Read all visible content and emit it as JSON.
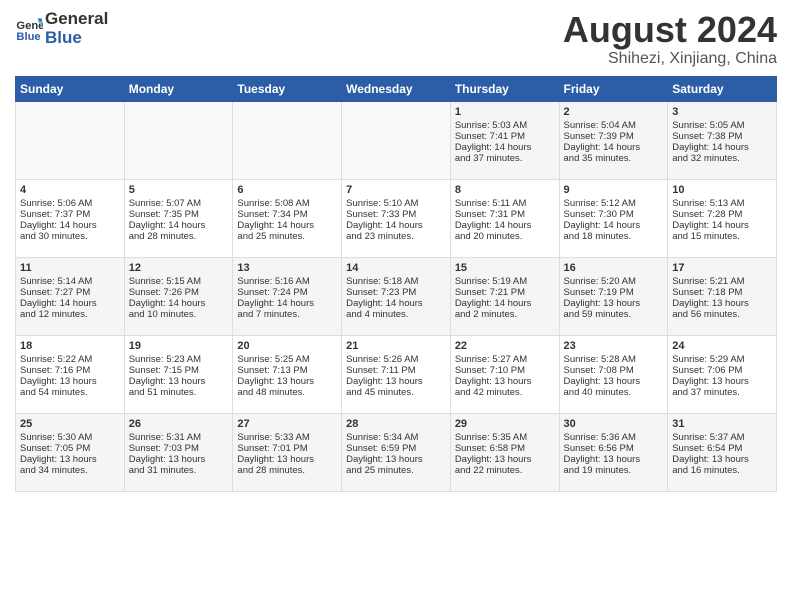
{
  "logo": {
    "line1": "General",
    "line2": "Blue"
  },
  "title": "August 2024",
  "subtitle": "Shihezi, Xinjiang, China",
  "days_of_week": [
    "Sunday",
    "Monday",
    "Tuesday",
    "Wednesday",
    "Thursday",
    "Friday",
    "Saturday"
  ],
  "weeks": [
    [
      {
        "day": "",
        "info": ""
      },
      {
        "day": "",
        "info": ""
      },
      {
        "day": "",
        "info": ""
      },
      {
        "day": "",
        "info": ""
      },
      {
        "day": "1",
        "info": "Sunrise: 5:03 AM\nSunset: 7:41 PM\nDaylight: 14 hours\nand 37 minutes."
      },
      {
        "day": "2",
        "info": "Sunrise: 5:04 AM\nSunset: 7:39 PM\nDaylight: 14 hours\nand 35 minutes."
      },
      {
        "day": "3",
        "info": "Sunrise: 5:05 AM\nSunset: 7:38 PM\nDaylight: 14 hours\nand 32 minutes."
      }
    ],
    [
      {
        "day": "4",
        "info": "Sunrise: 5:06 AM\nSunset: 7:37 PM\nDaylight: 14 hours\nand 30 minutes."
      },
      {
        "day": "5",
        "info": "Sunrise: 5:07 AM\nSunset: 7:35 PM\nDaylight: 14 hours\nand 28 minutes."
      },
      {
        "day": "6",
        "info": "Sunrise: 5:08 AM\nSunset: 7:34 PM\nDaylight: 14 hours\nand 25 minutes."
      },
      {
        "day": "7",
        "info": "Sunrise: 5:10 AM\nSunset: 7:33 PM\nDaylight: 14 hours\nand 23 minutes."
      },
      {
        "day": "8",
        "info": "Sunrise: 5:11 AM\nSunset: 7:31 PM\nDaylight: 14 hours\nand 20 minutes."
      },
      {
        "day": "9",
        "info": "Sunrise: 5:12 AM\nSunset: 7:30 PM\nDaylight: 14 hours\nand 18 minutes."
      },
      {
        "day": "10",
        "info": "Sunrise: 5:13 AM\nSunset: 7:28 PM\nDaylight: 14 hours\nand 15 minutes."
      }
    ],
    [
      {
        "day": "11",
        "info": "Sunrise: 5:14 AM\nSunset: 7:27 PM\nDaylight: 14 hours\nand 12 minutes."
      },
      {
        "day": "12",
        "info": "Sunrise: 5:15 AM\nSunset: 7:26 PM\nDaylight: 14 hours\nand 10 minutes."
      },
      {
        "day": "13",
        "info": "Sunrise: 5:16 AM\nSunset: 7:24 PM\nDaylight: 14 hours\nand 7 minutes."
      },
      {
        "day": "14",
        "info": "Sunrise: 5:18 AM\nSunset: 7:23 PM\nDaylight: 14 hours\nand 4 minutes."
      },
      {
        "day": "15",
        "info": "Sunrise: 5:19 AM\nSunset: 7:21 PM\nDaylight: 14 hours\nand 2 minutes."
      },
      {
        "day": "16",
        "info": "Sunrise: 5:20 AM\nSunset: 7:19 PM\nDaylight: 13 hours\nand 59 minutes."
      },
      {
        "day": "17",
        "info": "Sunrise: 5:21 AM\nSunset: 7:18 PM\nDaylight: 13 hours\nand 56 minutes."
      }
    ],
    [
      {
        "day": "18",
        "info": "Sunrise: 5:22 AM\nSunset: 7:16 PM\nDaylight: 13 hours\nand 54 minutes."
      },
      {
        "day": "19",
        "info": "Sunrise: 5:23 AM\nSunset: 7:15 PM\nDaylight: 13 hours\nand 51 minutes."
      },
      {
        "day": "20",
        "info": "Sunrise: 5:25 AM\nSunset: 7:13 PM\nDaylight: 13 hours\nand 48 minutes."
      },
      {
        "day": "21",
        "info": "Sunrise: 5:26 AM\nSunset: 7:11 PM\nDaylight: 13 hours\nand 45 minutes."
      },
      {
        "day": "22",
        "info": "Sunrise: 5:27 AM\nSunset: 7:10 PM\nDaylight: 13 hours\nand 42 minutes."
      },
      {
        "day": "23",
        "info": "Sunrise: 5:28 AM\nSunset: 7:08 PM\nDaylight: 13 hours\nand 40 minutes."
      },
      {
        "day": "24",
        "info": "Sunrise: 5:29 AM\nSunset: 7:06 PM\nDaylight: 13 hours\nand 37 minutes."
      }
    ],
    [
      {
        "day": "25",
        "info": "Sunrise: 5:30 AM\nSunset: 7:05 PM\nDaylight: 13 hours\nand 34 minutes."
      },
      {
        "day": "26",
        "info": "Sunrise: 5:31 AM\nSunset: 7:03 PM\nDaylight: 13 hours\nand 31 minutes."
      },
      {
        "day": "27",
        "info": "Sunrise: 5:33 AM\nSunset: 7:01 PM\nDaylight: 13 hours\nand 28 minutes."
      },
      {
        "day": "28",
        "info": "Sunrise: 5:34 AM\nSunset: 6:59 PM\nDaylight: 13 hours\nand 25 minutes."
      },
      {
        "day": "29",
        "info": "Sunrise: 5:35 AM\nSunset: 6:58 PM\nDaylight: 13 hours\nand 22 minutes."
      },
      {
        "day": "30",
        "info": "Sunrise: 5:36 AM\nSunset: 6:56 PM\nDaylight: 13 hours\nand 19 minutes."
      },
      {
        "day": "31",
        "info": "Sunrise: 5:37 AM\nSunset: 6:54 PM\nDaylight: 13 hours\nand 16 minutes."
      }
    ]
  ]
}
